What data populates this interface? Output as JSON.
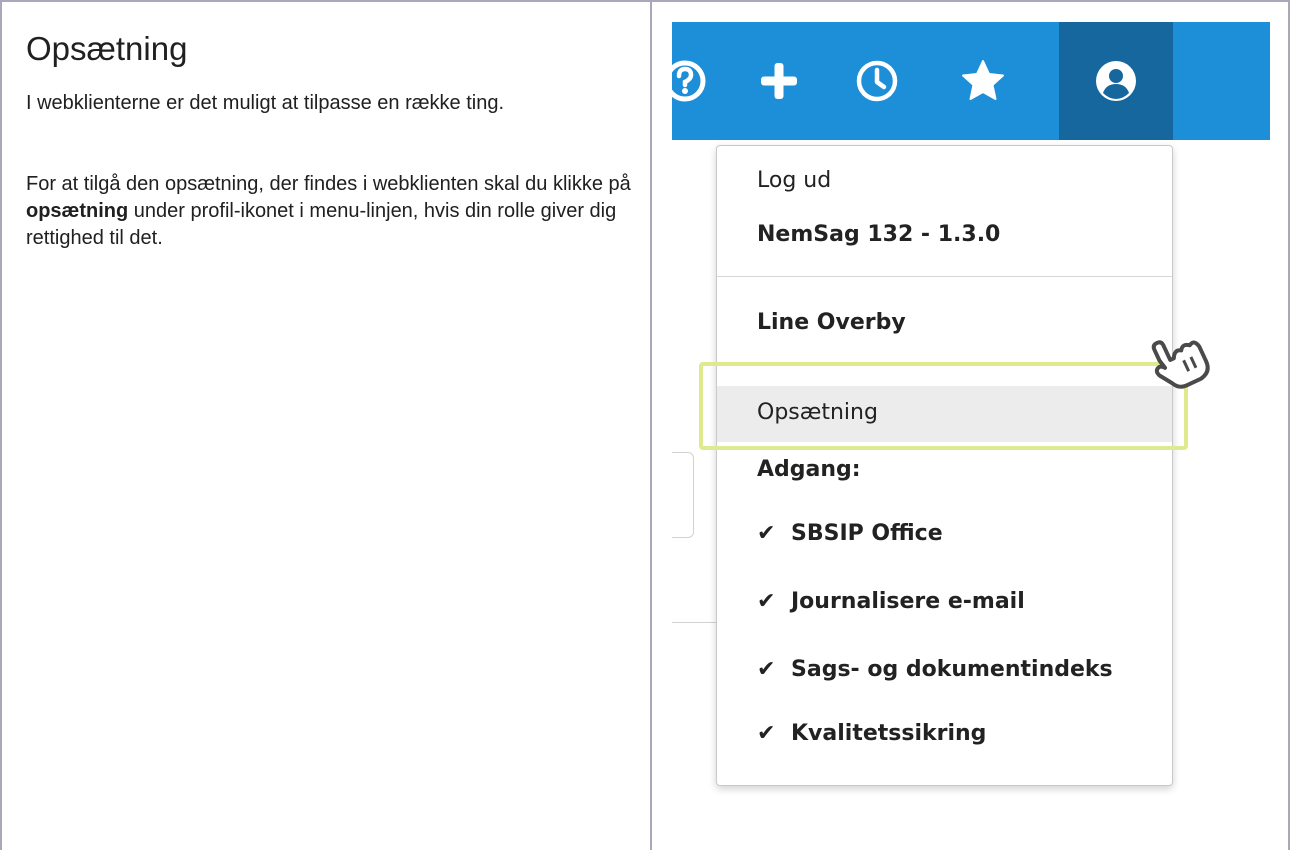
{
  "article": {
    "title": "Opsætning",
    "intro": "I webklienterne er det muligt at tilpasse en række ting.",
    "para_start": "For at tilgå den opsætning, der findes i webklienten skal du klikke på ",
    "para_bold": "opsætning",
    "para_end": " under profil-ikonet i menu-linjen, hvis din rolle giver dig rettighed til det."
  },
  "topbar": {
    "color": "#1c8fd8",
    "active_color": "#17679f",
    "icons": [
      "help-icon",
      "plus-icon",
      "clock-icon",
      "star-icon",
      "profile-icon"
    ]
  },
  "menu": {
    "logout": "Log ud",
    "version": "NemSag 132 - 1.3.0",
    "user": "Line Overby",
    "settings": "Opsætning",
    "access_heading": "Adgang:",
    "access_items": [
      "SBSIP Office",
      "Journalisere e-mail",
      "Sags- og dokumentindeks",
      "Kvalitetssikring"
    ],
    "check_glyph": "✔"
  },
  "highlight_color": "#dfe98e"
}
